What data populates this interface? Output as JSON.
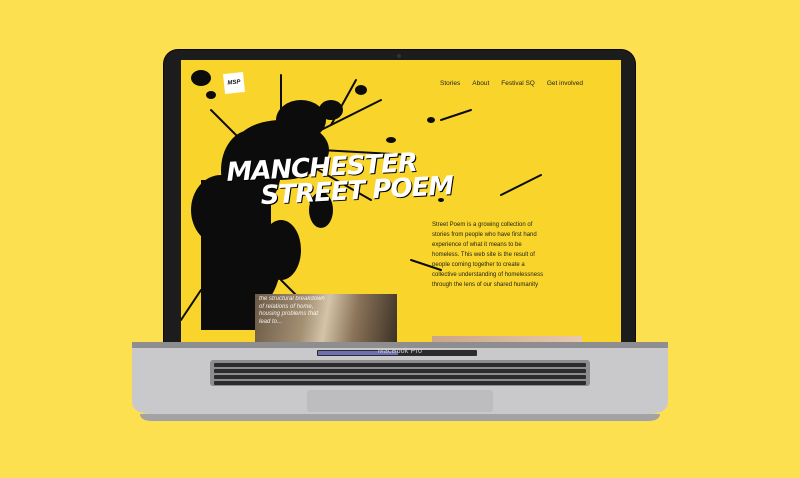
{
  "device": {
    "label": "MacBook Pro"
  },
  "site": {
    "logo_text": "MSP",
    "nav": [
      "Stories",
      "About",
      "Festival SQ",
      "Get involved"
    ],
    "title_line1": "MANCHESTER",
    "title_line2": "STREET POEM",
    "intro": "Street Poem is a growing collection of stories from people who have first hand experience of what it means to be homeless. This web site is the result of people coming together to create a collective understanding of homelessness through the lens of our shared humanity",
    "photo_caption": "the structural breakdown of relations of home, housing problems that lead to..."
  },
  "colors": {
    "background": "#fde04f",
    "screen": "#f9d52b",
    "ink": "#111111",
    "title": "#ffffff"
  }
}
